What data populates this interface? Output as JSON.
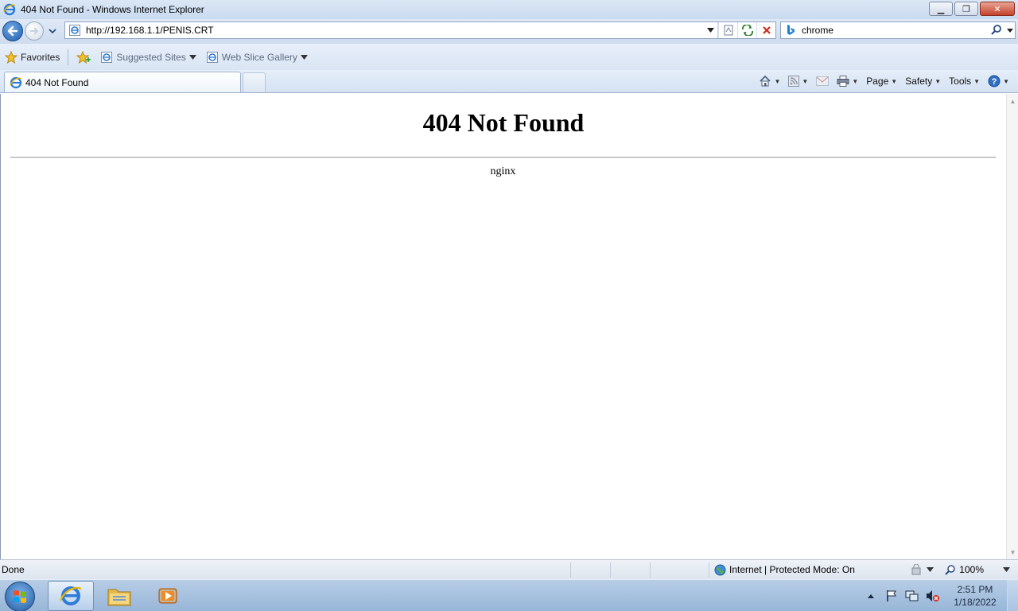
{
  "window": {
    "title": "404 Not Found - Windows Internet Explorer",
    "minimize_label": "▭",
    "restore_label": "❐",
    "close_label": "✕"
  },
  "nav": {
    "address_url": "http://192.168.1.1/PENIS.CRT",
    "search_value": "chrome",
    "icons": [
      "back-icon",
      "forward-icon",
      "dropdown-icon",
      "page-icon",
      "compatibility-icon",
      "refresh-icon",
      "stop-icon",
      "bing-icon",
      "search-icon"
    ]
  },
  "favorites_bar": {
    "favorites_label": "Favorites",
    "suggested_sites_label": "Suggested Sites",
    "web_slice_gallery_label": "Web Slice Gallery"
  },
  "tabs": [
    {
      "label": "404 Not Found",
      "active": true
    }
  ],
  "command_bar": {
    "page_label": "Page",
    "safety_label": "Safety",
    "tools_label": "Tools"
  },
  "content": {
    "heading": "404 Not Found",
    "server": "nginx"
  },
  "status_bar": {
    "status_text": "Done",
    "zone_text": "Internet | Protected Mode: On",
    "zoom_text": "100%"
  },
  "taskbar": {
    "time": "2:51 PM",
    "date": "1/18/2022",
    "apps": [
      "internet-explorer",
      "windows-explorer",
      "media-player"
    ]
  },
  "colors": {
    "ie_blue": "#1f5fae",
    "stop_red": "#d12a1a",
    "title_bar": "#c9daf0",
    "taskbar": "#98b6d8"
  }
}
